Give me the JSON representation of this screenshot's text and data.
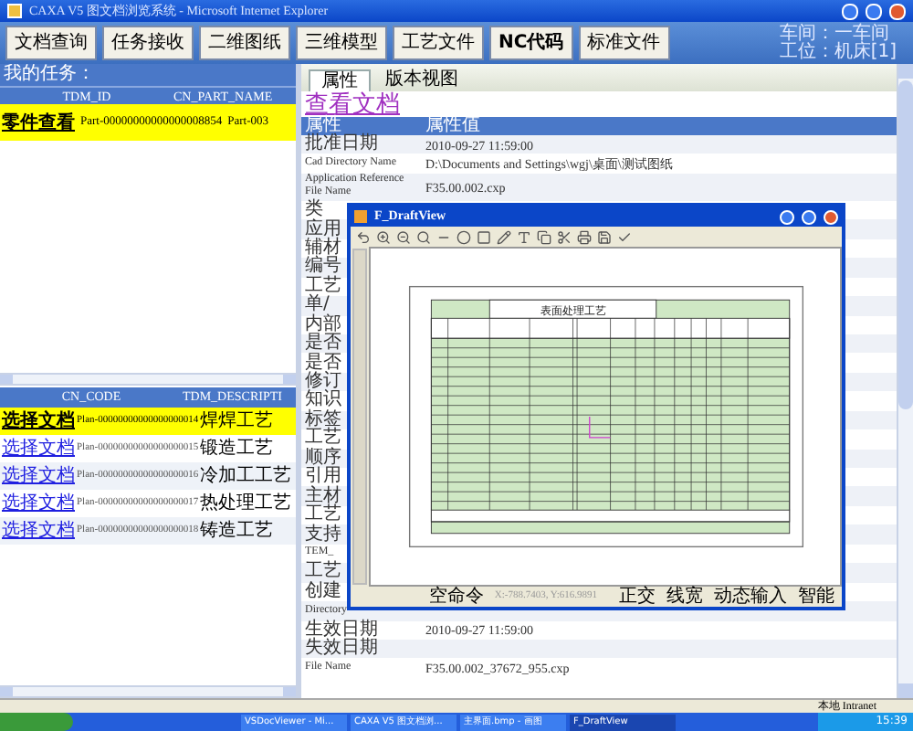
{
  "window": {
    "title": "CAXA V5 图文档浏览系统 - Microsoft Internet Explorer"
  },
  "toolbar": {
    "buttons": [
      {
        "label": "文档查询",
        "bold": false
      },
      {
        "label": "任务接收",
        "bold": false
      },
      {
        "label": "二维图纸",
        "bold": false
      },
      {
        "label": "三维模型",
        "bold": false
      },
      {
        "label": "工艺文件",
        "bold": false
      },
      {
        "label": "NC代码",
        "bold": true
      },
      {
        "label": "标准文件",
        "bold": false
      }
    ],
    "info": [
      "车间：一车间",
      "工位：机床[1]"
    ]
  },
  "tasks": {
    "label": "我的任务：",
    "columns": [
      "TDM_ID",
      "CN_PART_NAME"
    ],
    "rows": [
      {
        "link": "零件查看",
        "cells": [
          "Part-00000000000000008854",
          "Part-003"
        ],
        "selected": true
      }
    ]
  },
  "plans": {
    "columns": [
      "CN_CODE",
      "TDM_DESCRIPTI"
    ],
    "rows": [
      {
        "link": "选择文档",
        "cells": [
          "Plan-00000000000000000014",
          "焊焊工艺"
        ],
        "selected": true
      },
      {
        "link": "选择文档",
        "cells": [
          "Plan-00000000000000000015",
          "锻造工艺"
        ],
        "selected": false
      },
      {
        "link": "选择文档",
        "cells": [
          "Plan-00000000000000000016",
          "冷加工工艺"
        ],
        "selected": false
      },
      {
        "link": "选择文档",
        "cells": [
          "Plan-00000000000000000017",
          "热处理工艺"
        ],
        "selected": false
      },
      {
        "link": "选择文档",
        "cells": [
          "Plan-00000000000000000018",
          "铸造工艺"
        ],
        "selected": false
      }
    ]
  },
  "detail": {
    "tabs": [
      {
        "label": "属性",
        "selected": true
      },
      {
        "label": "版本视图",
        "selected": false
      }
    ],
    "heading": "查看文档",
    "columns": [
      "属性",
      "属性值"
    ],
    "rows": [
      {
        "name": "批准日期",
        "value": "2010-09-27 11:59:00"
      },
      {
        "name": "Cad Directory Name",
        "value": "D:\\Documents and Settings\\wgj\\桌面\\测试图纸"
      },
      {
        "name": "Application Reference File Name",
        "value": "F35.00.002.cxp"
      },
      {
        "name": "类"
      },
      {
        "name": "应用"
      },
      {
        "name": "辅材"
      },
      {
        "name": "编号"
      },
      {
        "name": "工艺"
      },
      {
        "name": "单/"
      },
      {
        "name": "内部"
      },
      {
        "name": "是否"
      },
      {
        "name": "是否"
      },
      {
        "name": "修订"
      },
      {
        "name": "知识"
      },
      {
        "name": "标签"
      },
      {
        "name": "工艺"
      },
      {
        "name": "顺序"
      },
      {
        "name": "引用"
      },
      {
        "name": "主材"
      },
      {
        "name": "工艺"
      },
      {
        "name": "支持"
      },
      {
        "name": "TEM_"
      },
      {
        "name": "工艺"
      },
      {
        "name": "创建"
      },
      {
        "name": "Directory"
      },
      {
        "name": "生效日期",
        "value": "2010-09-27 11:59:00"
      },
      {
        "name": "失效日期"
      },
      {
        "name": "File Name",
        "value": "F35.00.002_37672_955.cxp"
      }
    ]
  },
  "draft_window": {
    "title": "F_DraftView",
    "sheet_title": "表面处理工艺",
    "status": {
      "command": "空命令",
      "coords": "X:-788.7403, Y:616.9891",
      "toggles": [
        "正交",
        "线宽",
        "动态输入",
        "智能"
      ]
    }
  },
  "ie_status": {
    "zone": "本地 Intranet"
  },
  "taskbar": {
    "items": [
      {
        "label": "VSDocViewer - Mi...",
        "selected": false
      },
      {
        "label": "CAXA V5 图文档浏...",
        "selected": false
      },
      {
        "label": "主界面.bmp - 画图",
        "selected": false
      },
      {
        "label": "F_DraftView",
        "selected": true
      }
    ],
    "clock": "15:39"
  }
}
